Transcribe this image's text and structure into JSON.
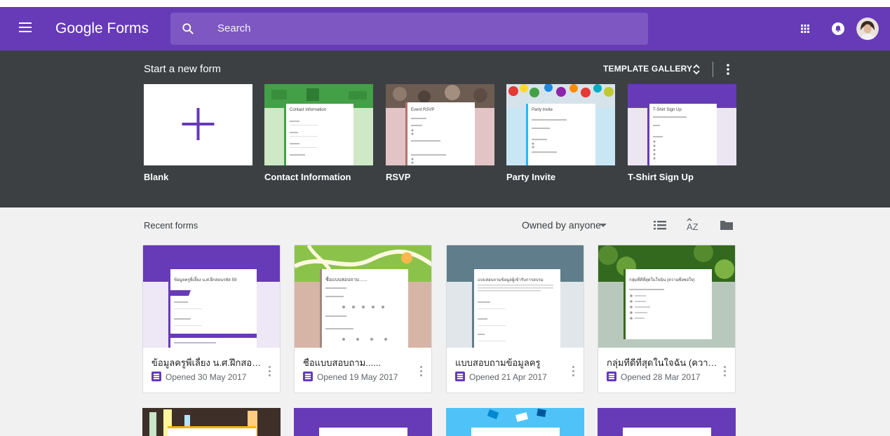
{
  "header": {
    "app_title": "Google Forms",
    "search_placeholder": "Search",
    "icons": [
      "menu-icon",
      "search-icon",
      "apps-grid-icon",
      "notifications-icon",
      "avatar"
    ]
  },
  "templates": {
    "section_title": "Start a new form",
    "gallery_label": "TEMPLATE GALLERY",
    "items": [
      {
        "label": "Blank"
      },
      {
        "label": "Contact Information"
      },
      {
        "label": "RSVP"
      },
      {
        "label": "Party Invite"
      },
      {
        "label": "T-Shirt Sign Up"
      }
    ]
  },
  "thumbnails": {
    "contact": {
      "title": "Contact information"
    },
    "rsvp": {
      "title": "Event RSVP"
    },
    "party": {
      "title": "Party Invite"
    },
    "tshirt": {
      "title": "T-Shirt Sign Up"
    }
  },
  "recent": {
    "section_title": "Recent forms",
    "owner_filter": "Owned by anyone",
    "forms": [
      {
        "title": "ข้อมูลครูพี่เลี้ยง น.ศ.ฝึกสอนรห้...",
        "opened": "Opened 30 May 2017",
        "thumb_title": "ข้อมูลครูพี่เลี้ยง น.ศ.ฝึกสอนรหัส 59"
      },
      {
        "title": "ชื่อแบบสอบถาม......",
        "opened": "Opened 19 May 2017",
        "thumb_title": "ชื่อแบบสอบถาม......"
      },
      {
        "title": "แบบสอบถามข้อมูลครู",
        "opened": "Opened 21 Apr 2017",
        "thumb_title": "แบบสอบถามข้อมูลผู้เข้ารับการอบรม"
      },
      {
        "title": "กลุ่มที่ดีที่สุดในใจฉัน (ความพึง...",
        "opened": "Opened 28 Mar 2017",
        "thumb_title": "กลุ่มที่ดีที่สุดในใจฉัน (ความพึงพอใจ)"
      }
    ]
  },
  "colors": {
    "brand_purple": "#673ab7",
    "template_band": "#3c4043",
    "recent_bg": "#f1f1f1"
  }
}
